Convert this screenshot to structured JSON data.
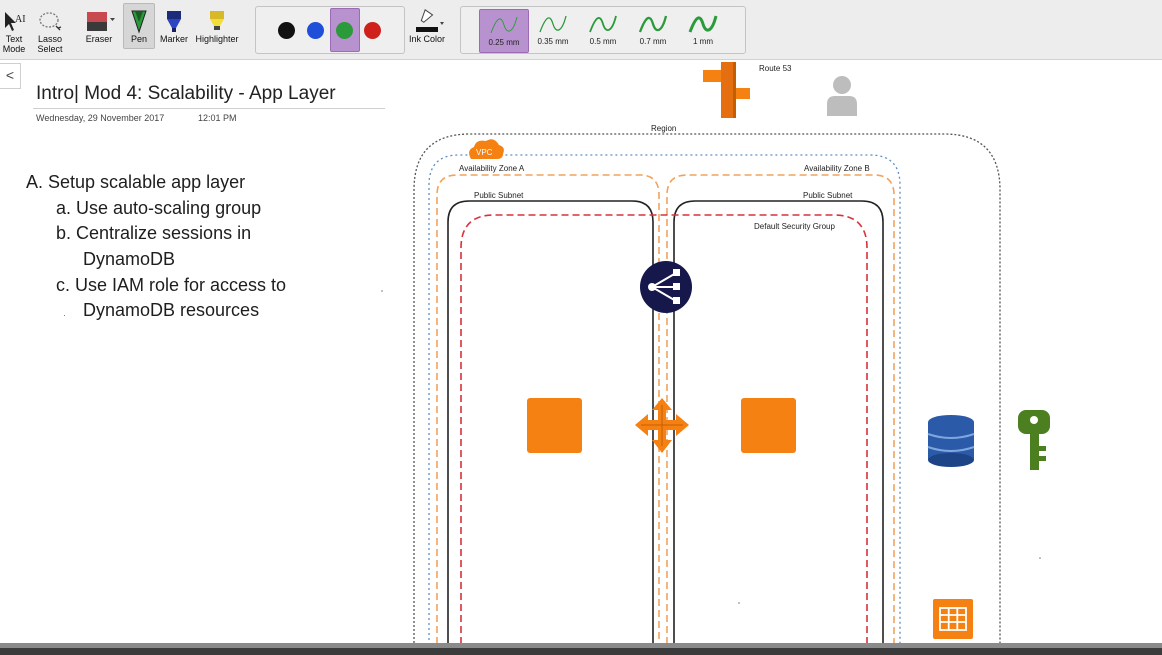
{
  "ribbon": {
    "tools": [
      {
        "id": "text-mode",
        "label_line1": "Text",
        "label_line2": "Mode",
        "icon": "text-cursor-icon"
      },
      {
        "id": "lasso-select",
        "label_line1": "Lasso",
        "label_line2": "Select",
        "icon": "lasso-icon"
      },
      {
        "id": "eraser",
        "label": "Eraser",
        "icon": "eraser-icon"
      },
      {
        "id": "pen",
        "label": "Pen",
        "icon": "pen-icon",
        "active": true
      },
      {
        "id": "marker",
        "label": "Marker",
        "icon": "marker-icon"
      },
      {
        "id": "highlighter",
        "label": "Highlighter",
        "icon": "highlighter-icon"
      }
    ],
    "colors": [
      {
        "name": "black",
        "hex": "#111111"
      },
      {
        "name": "blue",
        "hex": "#1f4fd8"
      },
      {
        "name": "green",
        "hex": "#2a9a3a",
        "selected": true
      },
      {
        "name": "red",
        "hex": "#d0201c"
      }
    ],
    "ink_color_label": "Ink Color",
    "thickness": [
      {
        "label": "0.25 mm",
        "selected": true
      },
      {
        "label": "0.35 mm"
      },
      {
        "label": "0.5 mm"
      },
      {
        "label": "0.7 mm"
      },
      {
        "label": "1 mm"
      }
    ]
  },
  "page": {
    "back_label": "<",
    "title": "Intro| Mod 4: Scalability - App Layer",
    "date": "Wednesday, 29 November 2017",
    "time": "12:01 PM",
    "outline": {
      "a": "A.  Setup scalable app layer",
      "a_a": "a.  Use auto-scaling group",
      "a_b": "b.  Centralize sessions in",
      "a_b2": "DynamoDB",
      "a_c": "c.  Use IAM role for access to",
      "a_c2": "DynamoDB resources",
      "stray_dot": "·"
    }
  },
  "diagram": {
    "route53_label": "Route 53",
    "region_label": "Region",
    "vpc_label": "VPC",
    "az_a_label": "Availability Zone A",
    "az_b_label": "Availability Zone B",
    "subnet_a_label": "Public Subnet",
    "subnet_b_label": "Public Subnet",
    "security_group_label": "Default Security Group",
    "colors": {
      "aws_orange": "#f58113",
      "az_dash": "#f0a35c",
      "vpc_dash": "#5a8fc4",
      "sg_dash": "#d9313b",
      "elb_navy": "#16174a",
      "dynamo_blue": "#2a5aa8",
      "iam_green": "#4b7f1f"
    }
  }
}
